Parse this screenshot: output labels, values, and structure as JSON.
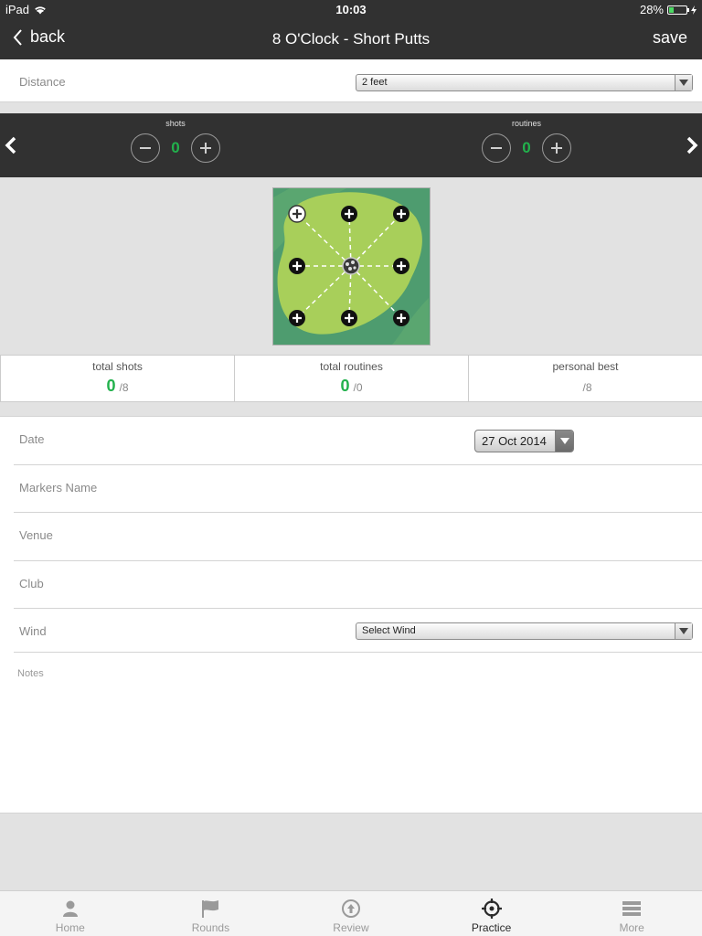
{
  "status": {
    "device": "iPad",
    "time": "10:03",
    "battery": "28%",
    "battery_level": 0.28
  },
  "nav": {
    "back_label": "back",
    "title": "8 O'Clock - Short Putts",
    "save_label": "save"
  },
  "distance": {
    "label": "Distance",
    "value": "2 feet"
  },
  "counters": {
    "shots": {
      "label": "shots",
      "value": "0"
    },
    "routines": {
      "label": "routines",
      "value": "0"
    }
  },
  "stats": [
    {
      "title": "total shots",
      "value": "0",
      "total": "/8"
    },
    {
      "title": "total routines",
      "value": "0",
      "total": "/0"
    },
    {
      "title": "personal best",
      "value": "",
      "total": "/8"
    }
  ],
  "form": {
    "date_label": "Date",
    "date_value": "27 Oct 2014",
    "markers_label": "Markers Name",
    "venue_label": "Venue",
    "club_label": "Club",
    "wind_label": "Wind",
    "wind_value": "Select Wind",
    "notes_label": "Notes"
  },
  "tabs": [
    {
      "label": "Home",
      "icon": "person-icon"
    },
    {
      "label": "Rounds",
      "icon": "flag-icon"
    },
    {
      "label": "Review",
      "icon": "upload-circle-icon"
    },
    {
      "label": "Practice",
      "icon": "target-icon",
      "active": true
    },
    {
      "label": "More",
      "icon": "menu-icon"
    }
  ],
  "colors": {
    "accent_green": "#22b14c",
    "bar_dark": "#313131",
    "green_light": "#a8cf5a",
    "green_dark": "#4a9a6e"
  }
}
